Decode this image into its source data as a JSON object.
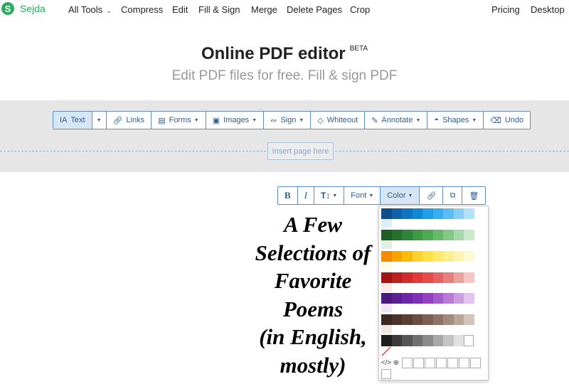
{
  "nav": {
    "brand": "Sejda",
    "logo_letter": "S",
    "items": [
      "All Tools",
      "Compress",
      "Edit",
      "Fill & Sign",
      "Merge",
      "Delete Pages",
      "Crop"
    ],
    "right": [
      "Pricing",
      "Desktop"
    ]
  },
  "hero": {
    "title": "Online PDF editor",
    "badge": "BETA",
    "subtitle": "Edit PDF files for free. Fill & sign PDF"
  },
  "toolbar": {
    "text": "Text",
    "links": "Links",
    "forms": "Forms",
    "images": "Images",
    "sign": "Sign",
    "whiteout": "Whiteout",
    "annotate": "Annotate",
    "shapes": "Shapes",
    "undo": "Undo"
  },
  "insert_page": "Insert page here",
  "text_toolbar": {
    "bold": "B",
    "italic": "I",
    "size": "T↕",
    "font": "Font",
    "color": "Color"
  },
  "poem_lines": [
    "A Few",
    "Selections of",
    "Favorite",
    "Poems",
    "(in English,",
    "mostly)"
  ],
  "palette": {
    "rows": [
      [
        "#0d4f8b",
        "#0f63a8",
        "#0f75c2",
        "#1188d6",
        "#1f9fe8",
        "#35aef2",
        "#5bbdf3",
        "#86cff7",
        "#b2e1fa"
      ],
      [
        "#1f5e25",
        "#25702c",
        "#2e8537",
        "#3b9a43",
        "#4cab52",
        "#66b96b",
        "#84c888",
        "#a6d8a8",
        "#cae8cb"
      ],
      [
        "#f28b00",
        "#f6a400",
        "#f8bb0a",
        "#fbd330",
        "#fde047",
        "#fde96a",
        "#fdef8e",
        "#fdf4b2",
        "#fef9d6"
      ],
      [
        "#a31515",
        "#bb1f1f",
        "#d32b2b",
        "#e23838",
        "#e64b4b",
        "#e36262",
        "#e67e7e",
        "#ee9f9f",
        "#f6c6c6"
      ],
      [
        "#4a1a7a",
        "#5a1f91",
        "#6d27a6",
        "#8030b6",
        "#9440c2",
        "#a45bcb",
        "#b77ad5",
        "#cb9edf",
        "#e0c6ec"
      ],
      [
        "#3a2822",
        "#4a332b",
        "#5b3f35",
        "#6b4d42",
        "#7c5e52",
        "#8f7367",
        "#a38b80",
        "#b9a59c",
        "#d2c3bc"
      ]
    ],
    "extras": [
      "#ddeefa",
      "#e1f0e2",
      "#fffbe6",
      "#fde8e8",
      "#f0e6f7",
      "#ede6e2"
    ],
    "greys": [
      "#1e1e1e",
      "#3a3a3a",
      "#555555",
      "#707070",
      "#8a8a8a",
      "#a8a8a8",
      "#c4c4c4",
      "#e0e0e0",
      "#ffffff"
    ]
  }
}
